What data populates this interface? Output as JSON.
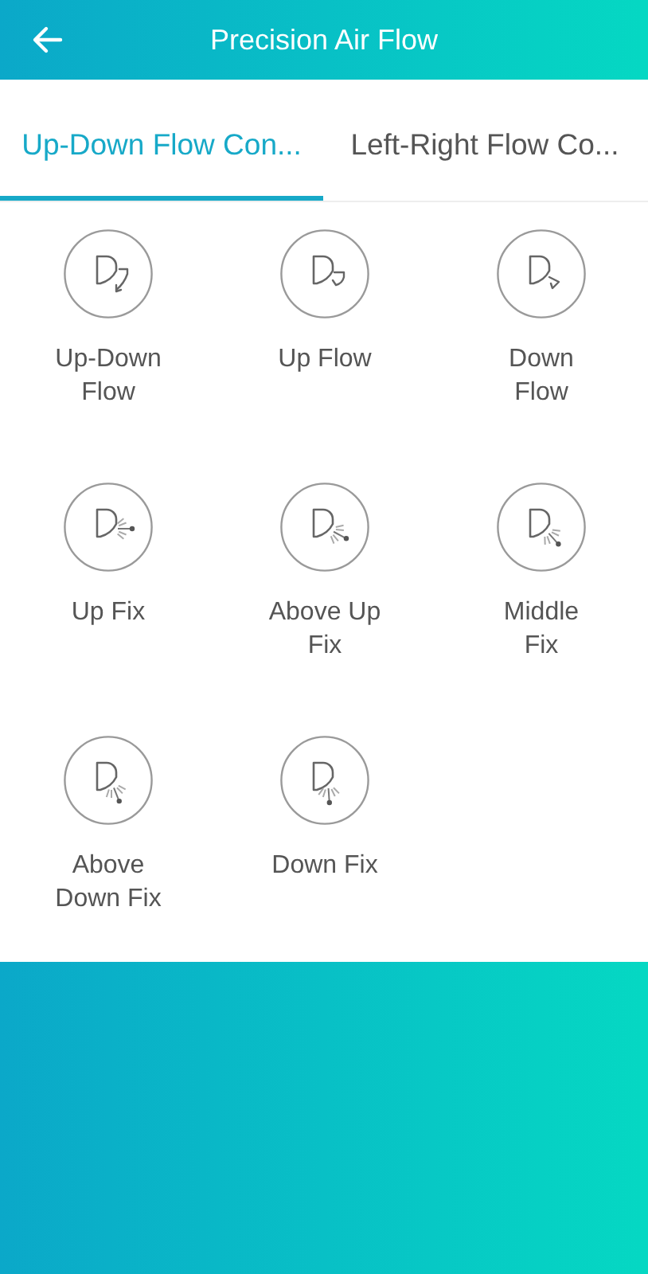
{
  "header": {
    "title": "Precision Air Flow"
  },
  "tabs": [
    {
      "label": "Up-Down Flow Con...",
      "selected": true
    },
    {
      "label": "Left-Right Flow Co...",
      "selected": false
    }
  ],
  "modes": [
    {
      "kind": "swing-both",
      "label": [
        "Up-Down",
        "Flow"
      ]
    },
    {
      "kind": "swing-up",
      "label": [
        "Up Flow"
      ]
    },
    {
      "kind": "swing-down",
      "label": [
        "Down",
        "Flow"
      ]
    },
    {
      "kind": "fix-up",
      "label": [
        "Up Fix"
      ]
    },
    {
      "kind": "fix-above-up",
      "label": [
        "Above Up",
        "Fix"
      ]
    },
    {
      "kind": "fix-middle",
      "label": [
        "Middle",
        "Fix"
      ]
    },
    {
      "kind": "fix-above-down",
      "label": [
        "Above",
        "Down Fix"
      ]
    },
    {
      "kind": "fix-down",
      "label": [
        "Down Fix"
      ]
    }
  ]
}
